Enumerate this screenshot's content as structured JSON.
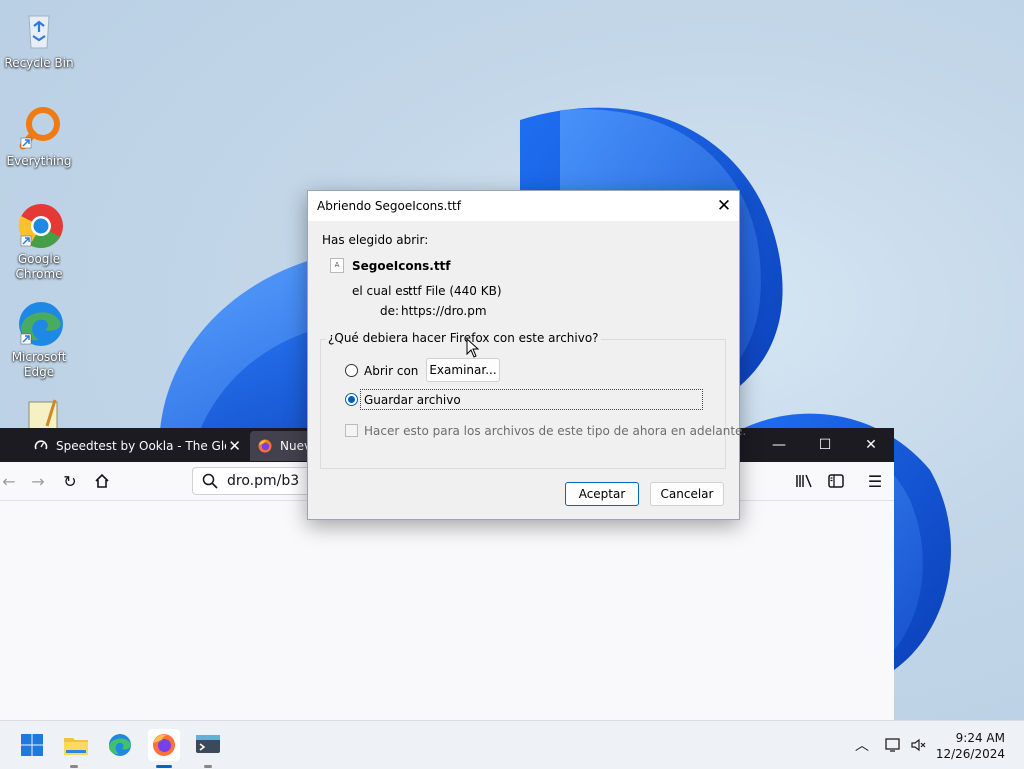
{
  "desktop": {
    "icons": [
      {
        "label": "Recycle Bin",
        "icon": "recycle-bin-icon"
      },
      {
        "label": "Everything",
        "icon": "everything-icon"
      },
      {
        "label": "Google Chrome",
        "icon": "chrome-icon"
      },
      {
        "label": "Microsoft Edge",
        "icon": "edge-icon"
      },
      {
        "label": "",
        "icon": "notepad-icon"
      }
    ]
  },
  "firefox": {
    "tabs": [
      {
        "label": "Speedtest by Ookla - The Glob",
        "icon": "speedtest-icon"
      },
      {
        "label": "Nuev",
        "icon": "firefox-icon"
      }
    ],
    "url": "dro.pm/b3",
    "toolbar_icons": [
      "back-icon",
      "forward-icon",
      "reload-icon",
      "home-icon",
      "library-icon",
      "sidebar-icon",
      "menu-icon"
    ]
  },
  "dialog": {
    "title": "Abriendo SegoeIcons.ttf",
    "intro": "Has elegido abrir:",
    "filename": "SegoeIcons.ttf",
    "type_label": "el cual es:",
    "type_value": "ttf File (440 KB)",
    "from_label": "de:",
    "from_value": "https://dro.pm",
    "question": "¿Qué debiera hacer Firefox con este archivo?",
    "open_with_label": "Abrir con",
    "browse_label": "Examinar...",
    "save_label": "Guardar archivo",
    "remember_label": "Hacer esto para los archivos de este tipo de ahora en adelante.",
    "selected_option": "save",
    "remember_checked": false,
    "ok_label": "Aceptar",
    "cancel_label": "Cancelar"
  },
  "taskbar": {
    "apps": [
      "start-icon",
      "file-explorer-icon",
      "edge-icon",
      "firefox-icon",
      "terminal-icon"
    ],
    "time": "9:24 AM",
    "date": "12/26/2024"
  }
}
